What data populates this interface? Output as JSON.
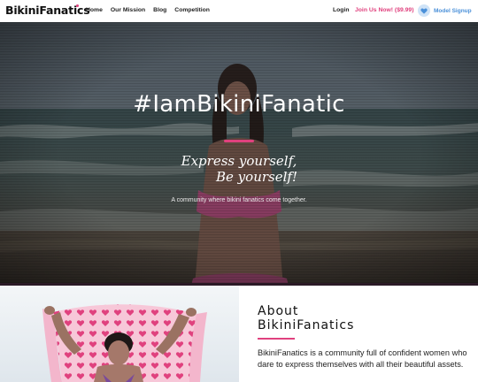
{
  "colors": {
    "accent": "#e0417e",
    "heart": "#4a90d9"
  },
  "nav": {
    "logo": "BikiniFanatics",
    "links": [
      "Home",
      "Our Mission",
      "Blog",
      "Competition"
    ],
    "login": "Login",
    "join": "Join Us Now! ($9.99)",
    "model_signup": "Model Signup"
  },
  "hero": {
    "title": "#IamBikiniFanatic",
    "script_line1": "Express yourself,",
    "script_line2": "Be yourself!",
    "subtitle": "A community where bikini fanatics come together."
  },
  "about": {
    "heading_line1": "About",
    "heading_line2": "BikiniFanatics",
    "body": "BikiniFanatics is a community full of confident women who dare to express themselves with all their beautiful assets."
  }
}
